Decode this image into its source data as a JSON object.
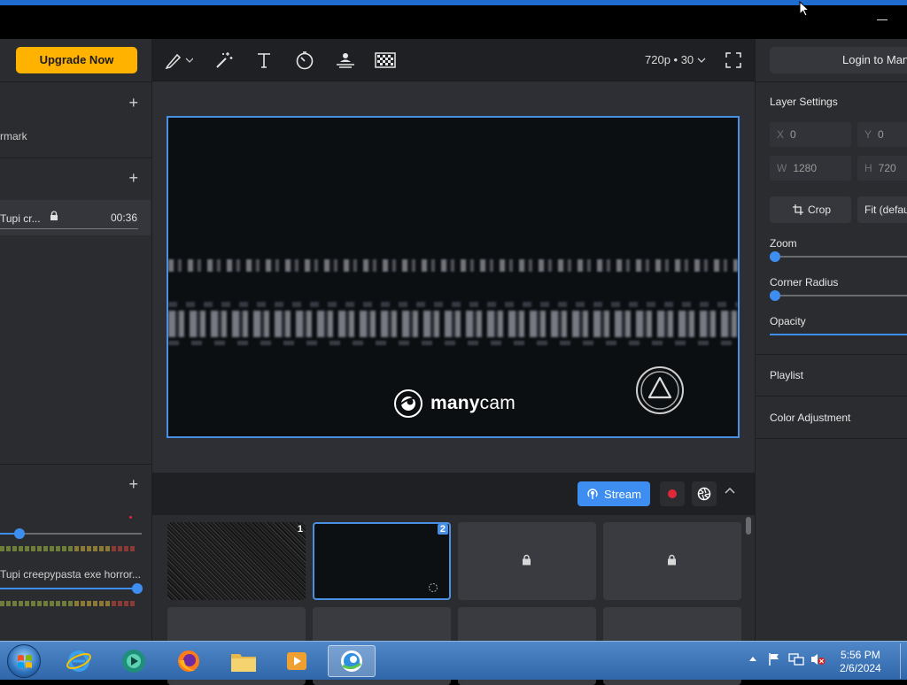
{
  "left_panel": {
    "upgrade_label": "Upgrade Now",
    "section1_item": "rmark",
    "media_item": {
      "name": "Tupi cr...",
      "duration": "00:36"
    },
    "audio_source": "Tupi creepypasta exe horror...",
    "slider1_level": 0.14,
    "slider2_level": 0.97
  },
  "toolbar": {
    "tools": [
      "draw-icon",
      "magic-wand-icon",
      "text-icon",
      "timer-icon",
      "lower-third-icon",
      "chroma-key-icon"
    ],
    "resolution": "720p • 30"
  },
  "preview": {
    "watermark_text_bold": "many",
    "watermark_text_light": "cam"
  },
  "controls": {
    "stream_label": "Stream"
  },
  "presets": [
    {
      "number": "1"
    },
    {
      "number": "2"
    }
  ],
  "right_panel": {
    "login_label": "Login to ManyCam",
    "layer_settings": "Layer Settings",
    "x_label": "X",
    "x_value": "0",
    "y_label": "Y",
    "y_value": "0",
    "w_label": "W",
    "w_value": "1280",
    "h_label": "H",
    "h_value": "720",
    "crop_label": "Crop",
    "fit_label": "Fit (default)",
    "zoom_label": "Zoom",
    "corner_radius_label": "Corner Radius",
    "opacity_label": "Opacity",
    "playlist_label": "Playlist",
    "color_adjustment_label": "Color Adjustment"
  },
  "taskbar": {
    "time": "5:56 PM",
    "date": "2/6/2024"
  },
  "colors": {
    "accent": "#3d8ef0",
    "upgrade": "#ffb300",
    "record": "#e0283a"
  }
}
